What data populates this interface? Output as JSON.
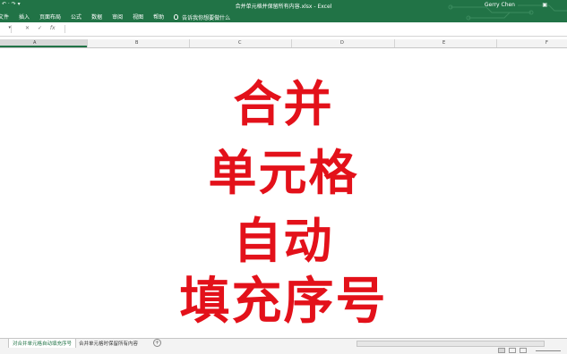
{
  "window": {
    "title": "合并单元格并保留所有内容.xlsx  -  Excel",
    "user": "Gerry Chen",
    "qat": "↶ · ↷  ▾"
  },
  "menu": {
    "items": [
      "文件",
      "插入",
      "页面布局",
      "公式",
      "数据",
      "审阅",
      "视图",
      "帮助"
    ],
    "tell_me": "告诉我你想要做什么"
  },
  "formula_bar": {
    "name_box": "▾",
    "cancel": "✕",
    "enter": "✓",
    "fx": "fx"
  },
  "columns": [
    "A",
    "B",
    "C",
    "D",
    "E",
    "F"
  ],
  "overlay": {
    "line1": "合并",
    "line2": "单元格",
    "line3": "自动",
    "line4": "填充序号",
    "color": "#e3111a"
  },
  "sheets": {
    "tabs": [
      "对合并单元格自动填充序号",
      "合并单元格时保留所有内容"
    ],
    "add": "+"
  },
  "colors": {
    "ribbon": "#217346",
    "accent": "#217346"
  }
}
